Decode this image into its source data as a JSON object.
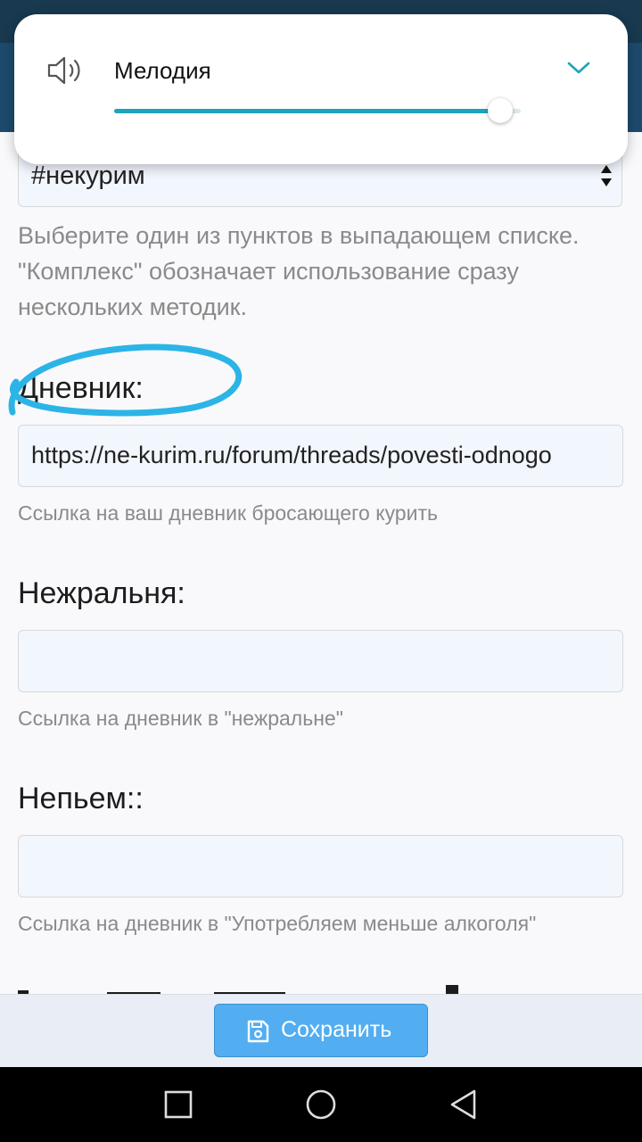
{
  "volume": {
    "label": "Мелодия",
    "level": 0.95
  },
  "form": {
    "method_select_value": "#некурим",
    "method_help": "Выберите один из пунктов в выпадающем списке. \"Комплекс\" обозначает использование сразу нескольких методик.",
    "diary": {
      "label": "Дневник:",
      "value": "https://ne-kurim.ru/forum/threads/povesti-odnogo",
      "help": "Ссылка на ваш дневник бросающего курить"
    },
    "nezhralnya": {
      "label": "Нежральня:",
      "value": "",
      "help": "Ссылка на дневник в \"нежральне\""
    },
    "nepyem": {
      "label": "Непьем::",
      "value": "",
      "help": "Ссылка на дневник в \"Употребляем меньше алкоголя\""
    }
  },
  "save_bar": {
    "save_label": "Сохранить"
  },
  "colors": {
    "accent": "#1ea3bd",
    "annotation": "#2cb4e6",
    "save_button": "#52aef0"
  }
}
